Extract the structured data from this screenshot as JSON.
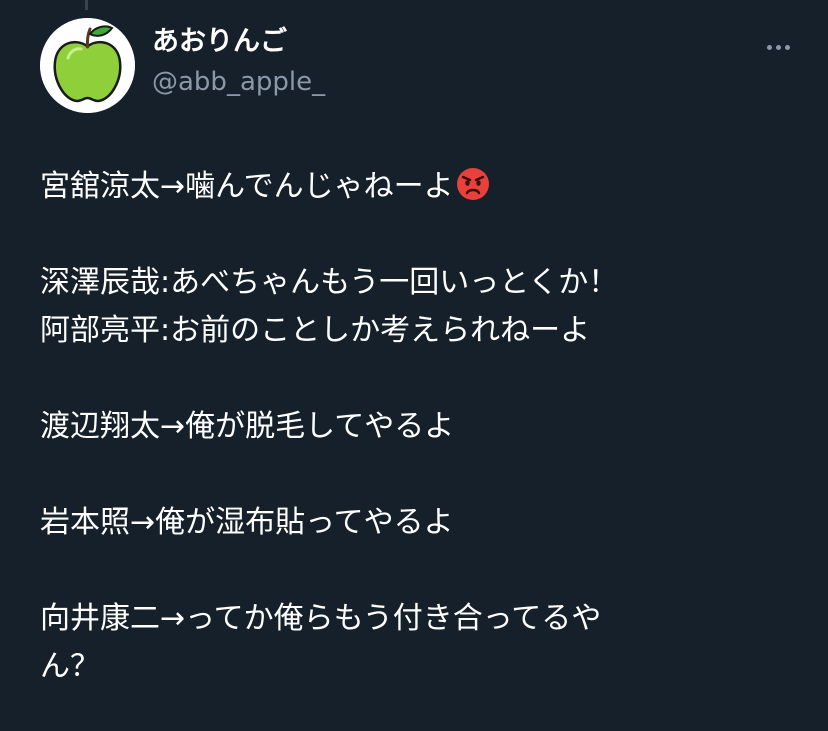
{
  "user": {
    "display_name": "あおりんご",
    "handle": "@abb_apple_",
    "avatar_icon": "green-apple-icon"
  },
  "actions": {
    "more_icon": "more-dots-icon"
  },
  "tweet": {
    "lines": [
      "宮舘涼太→噛んでんじゃねーよ",
      "",
      "深澤辰哉:あべちゃんもう一回いっとくか！",
      "阿部亮平:お前のことしか考えられねーよ",
      "",
      "渡辺翔太→俺が脱毛してやるよ",
      "",
      "岩本照→俺が湿布貼ってやるよ",
      "",
      "向井康二→ってか俺らもう付き合ってるや",
      "ん？"
    ],
    "emoji": "pouting-face-icon"
  },
  "colors": {
    "background": "#15202b",
    "text_primary": "#ffffff",
    "text_secondary": "#8b98a5",
    "apple_green": "#8fd03a",
    "emoji_red": "#e8403a"
  }
}
